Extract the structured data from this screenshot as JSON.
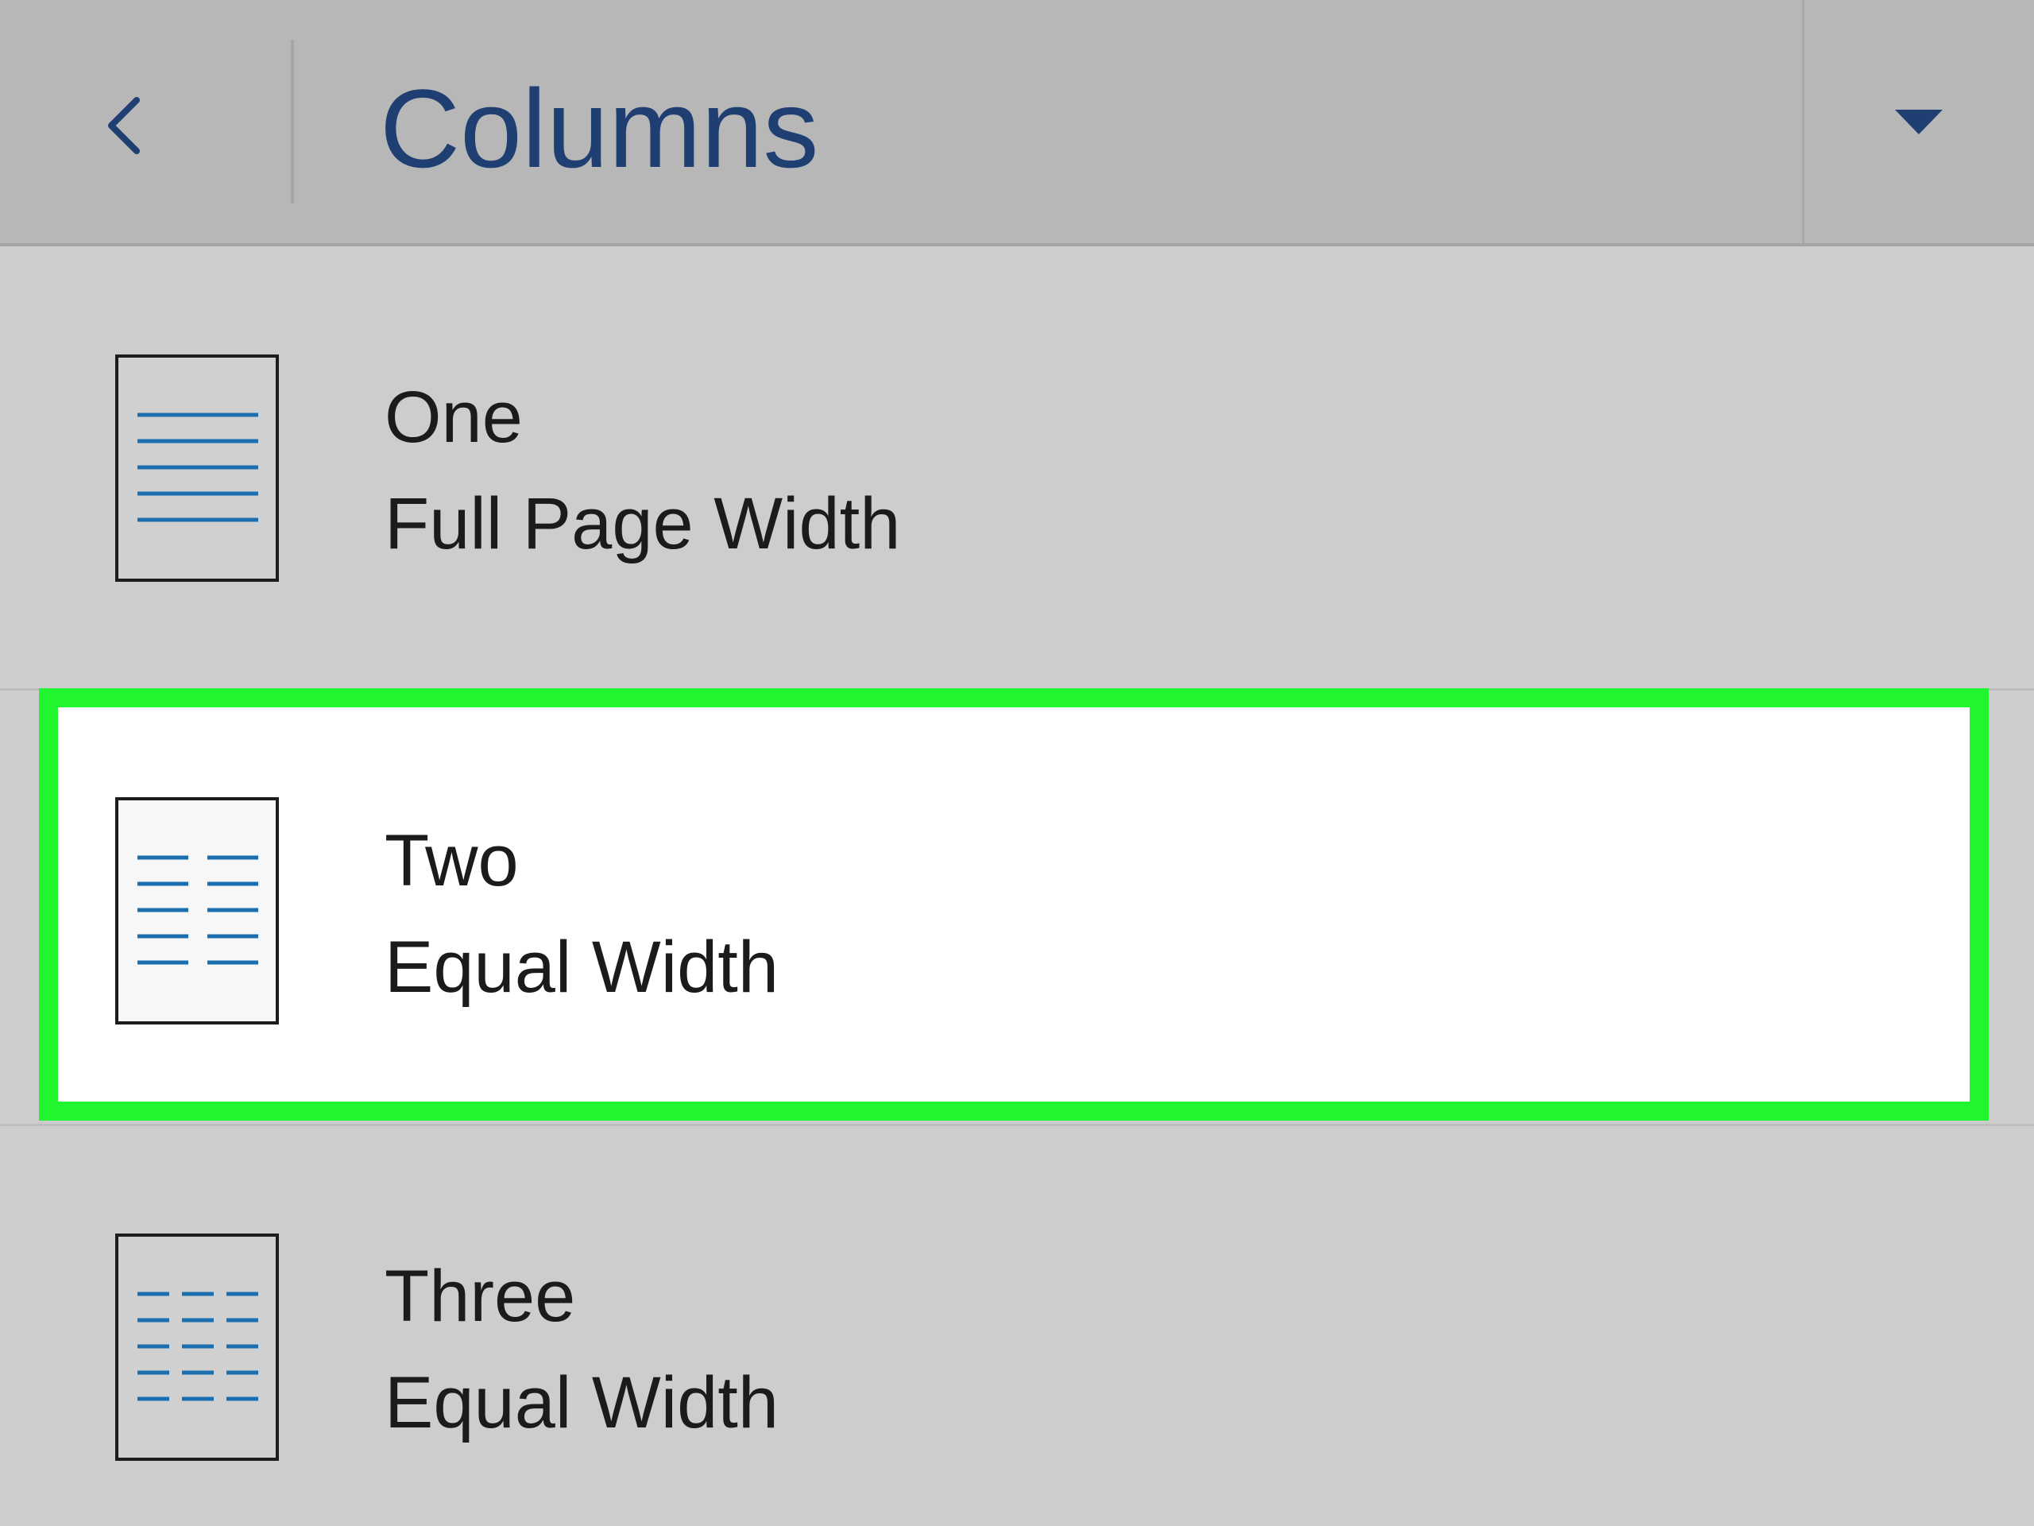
{
  "header": {
    "title": "Columns",
    "back_icon": "chevron-left-icon",
    "dropdown_icon": "caret-down-icon"
  },
  "options": [
    {
      "title": "One",
      "subtitle": "Full Page Width",
      "icon": "one-column-icon",
      "selected": false
    },
    {
      "title": "Two",
      "subtitle": "Equal Width",
      "icon": "two-columns-icon",
      "selected": true
    },
    {
      "title": "Three",
      "subtitle": "Equal Width",
      "icon": "three-columns-icon",
      "selected": false
    }
  ],
  "colors": {
    "title": "#1f3f72",
    "line_accent": "#1b6fae",
    "highlight": "#20f52f",
    "header_bg": "#b7b7b7",
    "list_bg": "#cdcdcd",
    "selected_bg": "#ffffff"
  }
}
